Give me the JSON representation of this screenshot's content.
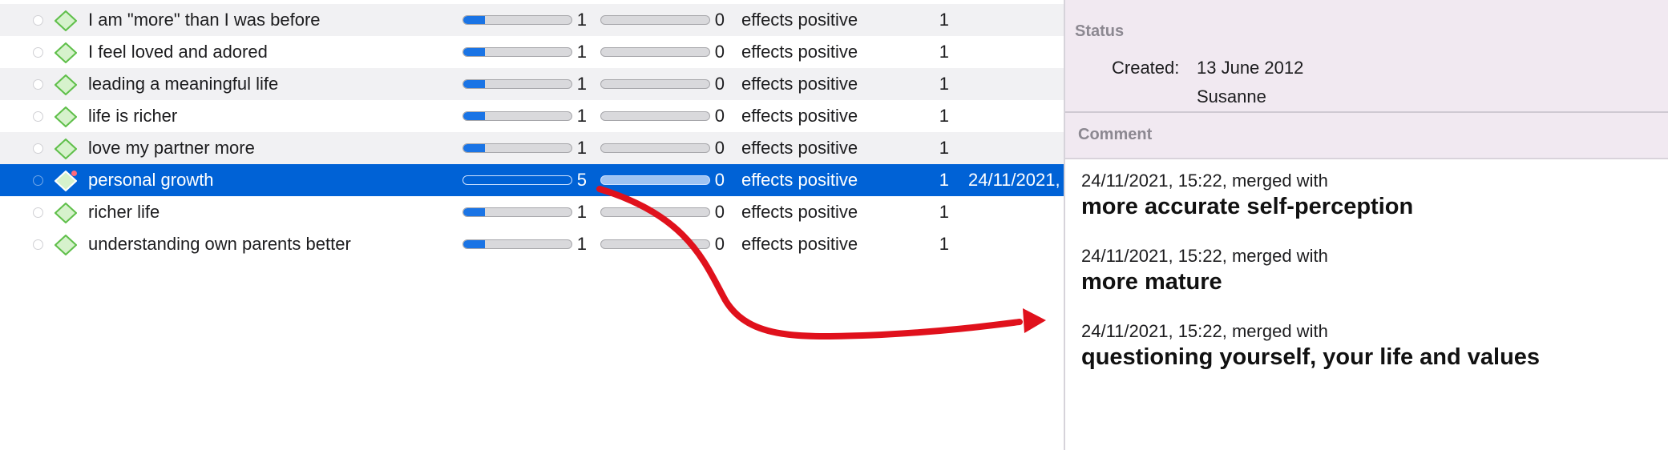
{
  "rows": [
    {
      "name": "I am \"more\" than I was before",
      "count": "1",
      "count2": "0",
      "relation": "effects positive",
      "count3": "1",
      "fill": 0.2
    },
    {
      "name": "I feel loved and adored",
      "count": "1",
      "count2": "0",
      "relation": "effects positive",
      "count3": "1",
      "fill": 0.2
    },
    {
      "name": "leading a meaningful life",
      "count": "1",
      "count2": "0",
      "relation": "effects positive",
      "count3": "1",
      "fill": 0.2
    },
    {
      "name": "life is richer",
      "count": "1",
      "count2": "0",
      "relation": "effects positive",
      "count3": "1",
      "fill": 0.2
    },
    {
      "name": "love my partner more",
      "count": "1",
      "count2": "0",
      "relation": "effects positive",
      "count3": "1",
      "fill": 0.2
    },
    {
      "name": "personal growth",
      "count": "5",
      "count2": "0",
      "relation": "effects positive",
      "count3": "1",
      "date": "24/11/2021,",
      "fill": 1.0,
      "selected": true
    },
    {
      "name": "richer life",
      "count": "1",
      "count2": "0",
      "relation": "effects positive",
      "count3": "1",
      "fill": 0.2
    },
    {
      "name": "understanding own parents better",
      "count": "1",
      "count2": "0",
      "relation": "effects positive",
      "count3": "1",
      "fill": 0.2
    }
  ],
  "inspector": {
    "status_title": "Status",
    "created_label": "Created:",
    "created_value": "13 June 2012",
    "author": "Susanne",
    "comment_title": "Comment",
    "comments": [
      {
        "meta": "24/11/2021, 15:22, merged with",
        "target": "more accurate self-perception"
      },
      {
        "meta": "24/11/2021, 15:22, merged with",
        "target": "more mature"
      },
      {
        "meta": "24/11/2021, 15:22, merged with",
        "target": "questioning yourself, your life and values"
      }
    ]
  },
  "colors": {
    "selection": "#0062d6",
    "row_alt": "#f1f1f3",
    "bar_fill": "#1a74e5",
    "panel_header": "#f1e9f1",
    "annotation_arrow": "#e0111c",
    "code_icon": "#5fbf4a"
  },
  "icons": {
    "row_radio": "circle-outline-icon",
    "code": "green-diamond-code-icon",
    "memo_marker": "red-dot-icon"
  }
}
